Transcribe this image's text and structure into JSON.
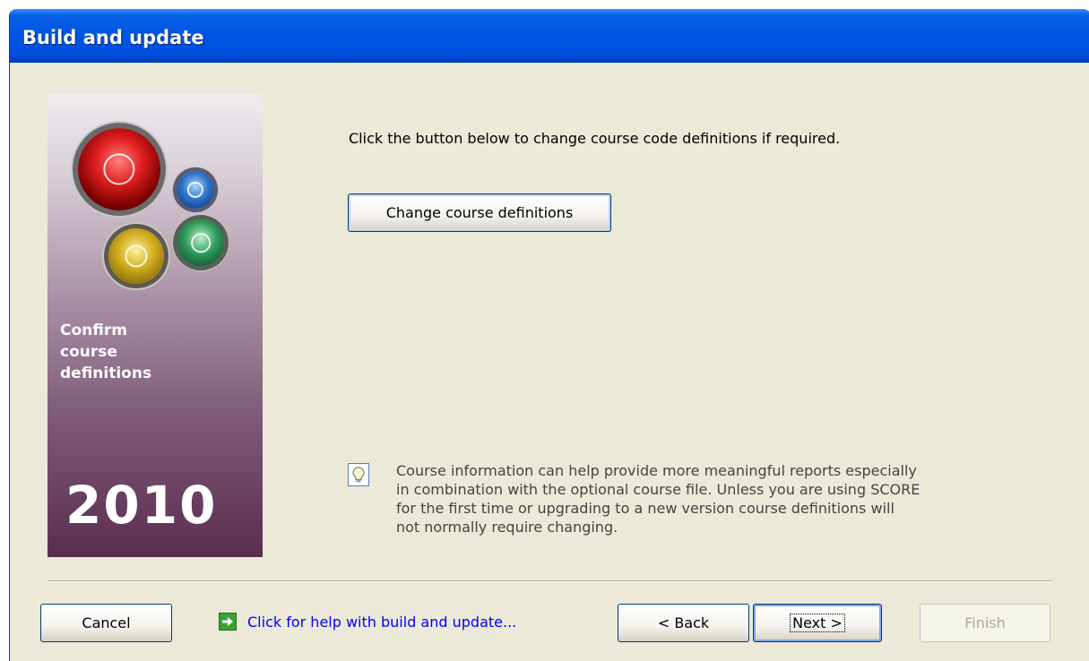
{
  "window": {
    "title": "Build and update"
  },
  "banner": {
    "caption_lines": [
      "Confirm",
      "course",
      "definitions"
    ],
    "year": "2010"
  },
  "main": {
    "instruction": "Click the button below to change course code definitions if required.",
    "change_button_label": "Change course definitions",
    "hint_lines": [
      "Course information can help provide more meaningful reports especially",
      "in combination with the optional course file. Unless you are using SCORE",
      "for the first time or upgrading to a new version course definitions will",
      "not normally require changing."
    ]
  },
  "footer": {
    "cancel_label": "Cancel",
    "help_link": "Click for help with build and update...",
    "back_label": "< Back",
    "next_label": "Next >",
    "finish_label": "Finish",
    "finish_enabled": false
  },
  "colors": {
    "titlebar": "#0054e3",
    "dialog_background": "#ece9d8",
    "link": "#0000ff",
    "banner_bottom": "#5a2d4e"
  },
  "icons": {
    "hint": "lightbulb-icon",
    "help": "green-arrow-icon"
  }
}
